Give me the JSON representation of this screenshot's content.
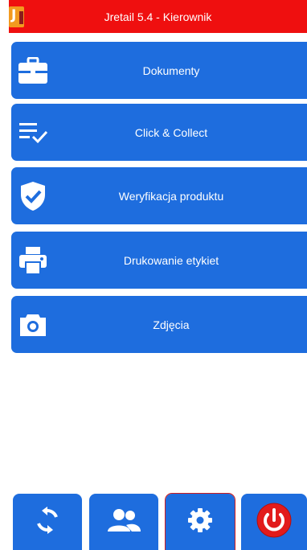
{
  "app": {
    "title": "Jretail 5.4 - Kierownik",
    "logo_letter": "J",
    "logo_text": "retail"
  },
  "menu": {
    "items": [
      {
        "label": "Dokumenty",
        "icon": "briefcase-icon"
      },
      {
        "label": "Click & Collect",
        "icon": "list-check-icon"
      },
      {
        "label": "Weryfikacja produktu",
        "icon": "shield-check-icon"
      },
      {
        "label": "Drukowanie etykiet",
        "icon": "printer-icon"
      },
      {
        "label": "Zdjęcia",
        "icon": "camera-icon"
      }
    ]
  },
  "bottom_bar": {
    "buttons": [
      {
        "icon": "sync-icon"
      },
      {
        "icon": "users-icon"
      },
      {
        "icon": "gear-icon",
        "selected": true
      },
      {
        "icon": "power-icon"
      }
    ]
  },
  "colors": {
    "titlebar": "#ef0f0f",
    "button_blue": "#1e6dde",
    "power_red": "#e21b1b",
    "selected_outline": "#d21c1c"
  }
}
